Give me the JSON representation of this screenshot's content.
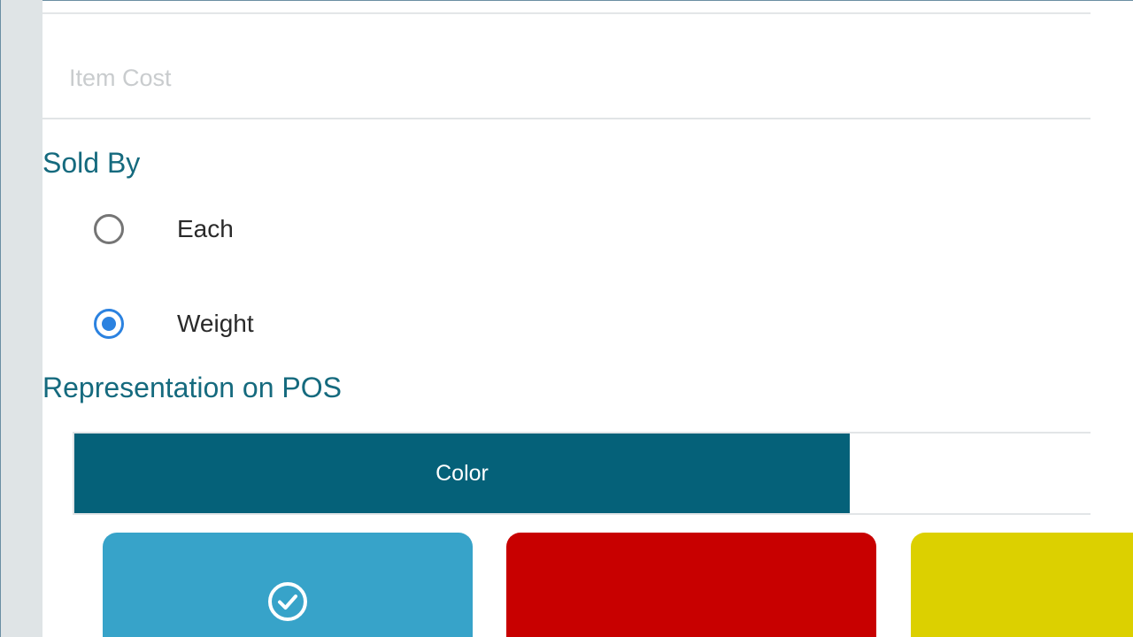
{
  "form": {
    "item_cost_placeholder": "Item Cost",
    "sold_by": {
      "title": "Sold By",
      "options": [
        {
          "label": "Each",
          "selected": false
        },
        {
          "label": "Weight",
          "selected": true
        }
      ]
    },
    "representation": {
      "title": "Representation on POS",
      "tabs": [
        {
          "label": "Color",
          "active": true
        },
        {
          "label": "",
          "active": false
        }
      ],
      "swatches": [
        {
          "color": "#37a3c9",
          "selected": true,
          "icon": "check-circle-icon"
        },
        {
          "color": "#c80000",
          "selected": false
        },
        {
          "color": "#dcd000",
          "selected": false
        }
      ]
    }
  },
  "colors": {
    "accent": "#156a7e",
    "tab_active": "#056179",
    "radio_selected": "#2b82e0"
  }
}
